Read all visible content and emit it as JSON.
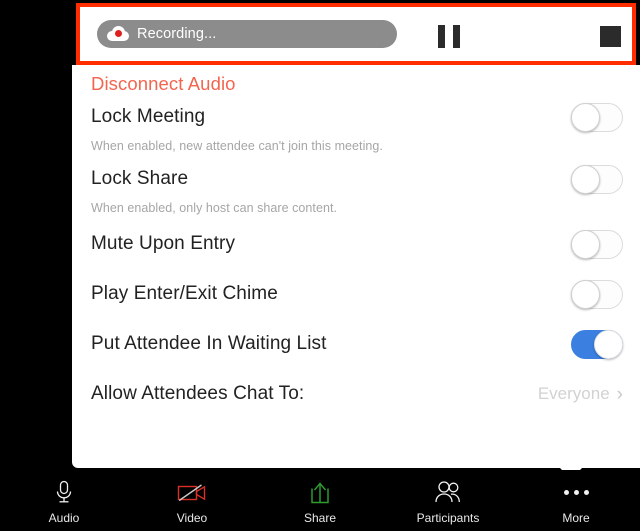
{
  "recording_bar": {
    "status_label": "Recording...",
    "icon": "cloud-record-icon",
    "pause_label": "Pause Recording",
    "stop_label": "Stop Recording",
    "highlight_color": "#ff2d00",
    "pill_color": "#8c8c8c"
  },
  "panel": {
    "disconnect_audio_label": "Disconnect Audio",
    "accent_red": "#f2654f",
    "toggle_on_color": "#3b7fe0",
    "rows": [
      {
        "title": "Lock Meeting",
        "subtitle": "When enabled, new attendee can't join this meeting.",
        "control": "toggle",
        "state": "off"
      },
      {
        "title": "Lock Share",
        "subtitle": "When enabled, only host can share content.",
        "control": "toggle",
        "state": "off"
      },
      {
        "title": "Mute Upon Entry",
        "subtitle": "",
        "control": "toggle",
        "state": "off"
      },
      {
        "title": "Play Enter/Exit Chime",
        "subtitle": "",
        "control": "toggle",
        "state": "off"
      },
      {
        "title": "Put Attendee In Waiting List",
        "subtitle": "",
        "control": "toggle",
        "state": "on"
      },
      {
        "title": "Allow Attendees Chat To:",
        "subtitle": "",
        "control": "value",
        "value": "Everyone",
        "chevron": "›"
      }
    ]
  },
  "toolbar": {
    "items": [
      {
        "label": "Audio",
        "icon": "microphone-icon",
        "color": "#f0f0f0"
      },
      {
        "label": "Video",
        "icon": "video-off-icon",
        "color": "#d93025"
      },
      {
        "label": "Share",
        "icon": "share-up-arrow-icon",
        "color": "#2e9b2e"
      },
      {
        "label": "Participants",
        "icon": "participants-icon",
        "color": "#f0f0f0"
      },
      {
        "label": "More",
        "icon": "more-dots-icon",
        "color": "#f0f0f0"
      }
    ]
  }
}
